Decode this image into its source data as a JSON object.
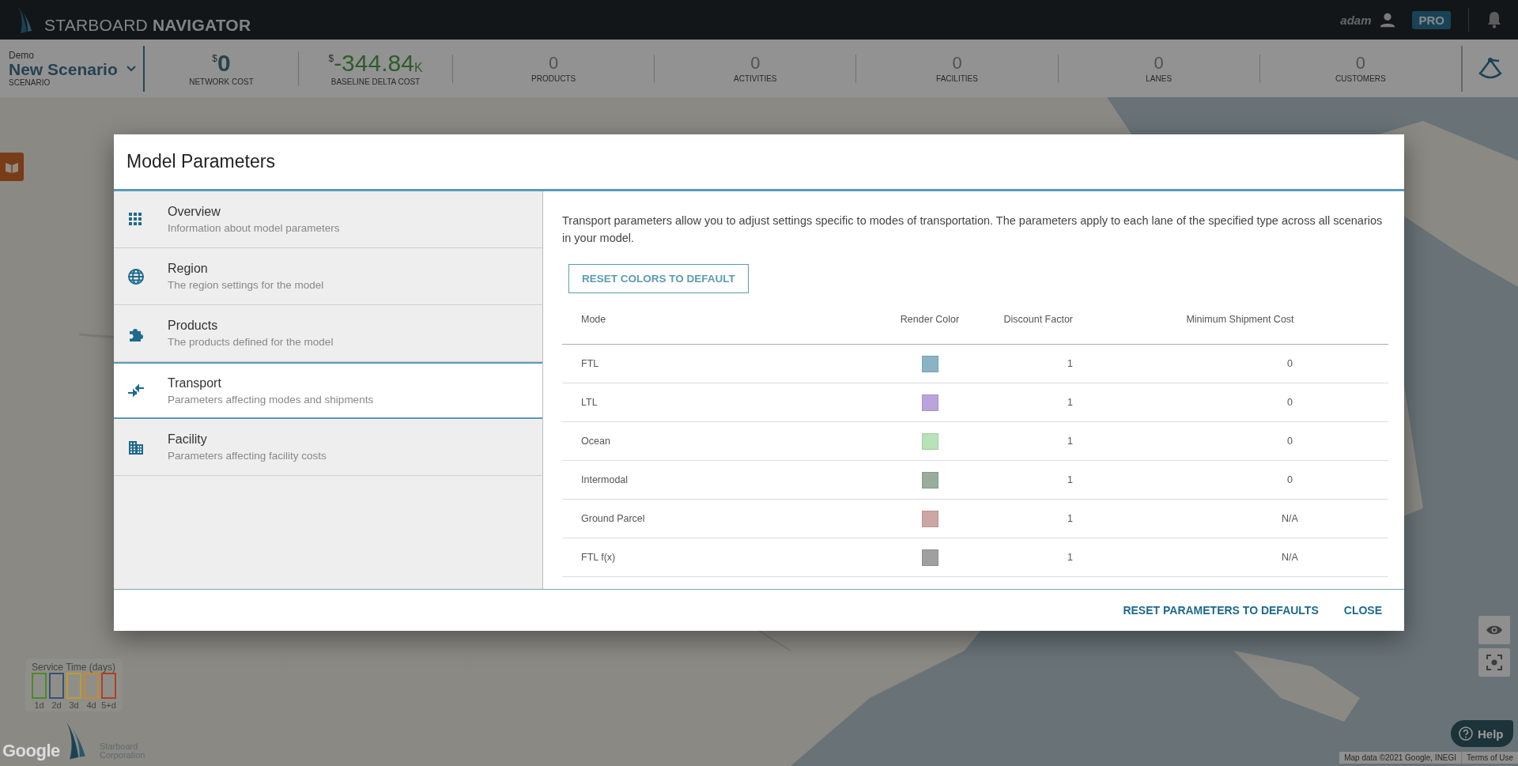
{
  "app": {
    "brand": "STARBOARD **NAVIGATOR**",
    "user": "adam",
    "plan_badge": "PRO"
  },
  "scenario": {
    "group": "Demo",
    "name": "New Scenario",
    "caption": "SCENARIO"
  },
  "stats": [
    {
      "kind": "cost",
      "currency": "$",
      "value": "0",
      "label": "NETWORK COST"
    },
    {
      "kind": "cost",
      "currency": "$",
      "value": "-344.84",
      "suffix": "K",
      "label": "BASELINE DELTA COST"
    },
    {
      "kind": "count",
      "value": "0",
      "label": "PRODUCTS"
    },
    {
      "kind": "count",
      "value": "0",
      "label": "ACTIVITIES"
    },
    {
      "kind": "count",
      "value": "0",
      "label": "FACILITIES"
    },
    {
      "kind": "count",
      "value": "0",
      "label": "LANES"
    },
    {
      "kind": "count",
      "value": "0",
      "label": "CUSTOMERS"
    }
  ],
  "modal": {
    "title": "Model Parameters",
    "sidebar": {
      "items": [
        {
          "title": "Overview",
          "subtitle": "Information about model parameters",
          "selected": false
        },
        {
          "title": "Region",
          "subtitle": "The region settings for the model",
          "selected": false
        },
        {
          "title": "Products",
          "subtitle": "The products defined for the model",
          "selected": false
        },
        {
          "title": "Transport",
          "subtitle": "Parameters affecting modes and shipments",
          "selected": true
        },
        {
          "title": "Facility",
          "subtitle": "Parameters affecting facility costs",
          "selected": false
        }
      ]
    },
    "description": "Transport parameters allow you to adjust settings specific to modes of transportation. The parameters apply to each lane of the specified type across all scenarios in your model.",
    "reset_colors_button": "RESET COLORS TO DEFAULT",
    "table": {
      "columns": [
        "Mode",
        "Render Color",
        "Discount Factor",
        "Minimum Shipment Cost"
      ],
      "rows": [
        {
          "mode": "FTL",
          "color": "#8ab4c6",
          "discount_factor": "1",
          "minimum_shipment_cost": "0"
        },
        {
          "mode": "LTL",
          "color": "#bba3dc",
          "discount_factor": "1",
          "minimum_shipment_cost": "0"
        },
        {
          "mode": "Ocean",
          "color": "#b8e2b8",
          "discount_factor": "1",
          "minimum_shipment_cost": "0"
        },
        {
          "mode": "Intermodal",
          "color": "#98ad9c",
          "discount_factor": "1",
          "minimum_shipment_cost": "0"
        },
        {
          "mode": "Ground Parcel",
          "color": "#cba6a3",
          "discount_factor": "1",
          "minimum_shipment_cost": "N/A"
        },
        {
          "mode": "FTL f(x)",
          "color": "#a0a0a0",
          "discount_factor": "1",
          "minimum_shipment_cost": "N/A"
        }
      ]
    },
    "buttons": [
      "RESET PARAMETERS TO DEFAULTS",
      "CLOSE"
    ]
  },
  "legend": {
    "title": "Service Time (days)",
    "items": [
      {
        "label": "1d",
        "color": "#4a8a2a"
      },
      {
        "label": "2d",
        "color": "#3c5070"
      },
      {
        "label": "3d",
        "color": "#c09a30"
      },
      {
        "label": "4d",
        "color": "#c88830"
      },
      {
        "label": "5+d",
        "color": "#b04020"
      }
    ]
  },
  "map_footer": {
    "google": "Google",
    "company_logo": "Starboard Corporation",
    "attribution": "Map data ©2021 Google, INEGI",
    "terms": "Terms of Use"
  },
  "help_button": "Help"
}
